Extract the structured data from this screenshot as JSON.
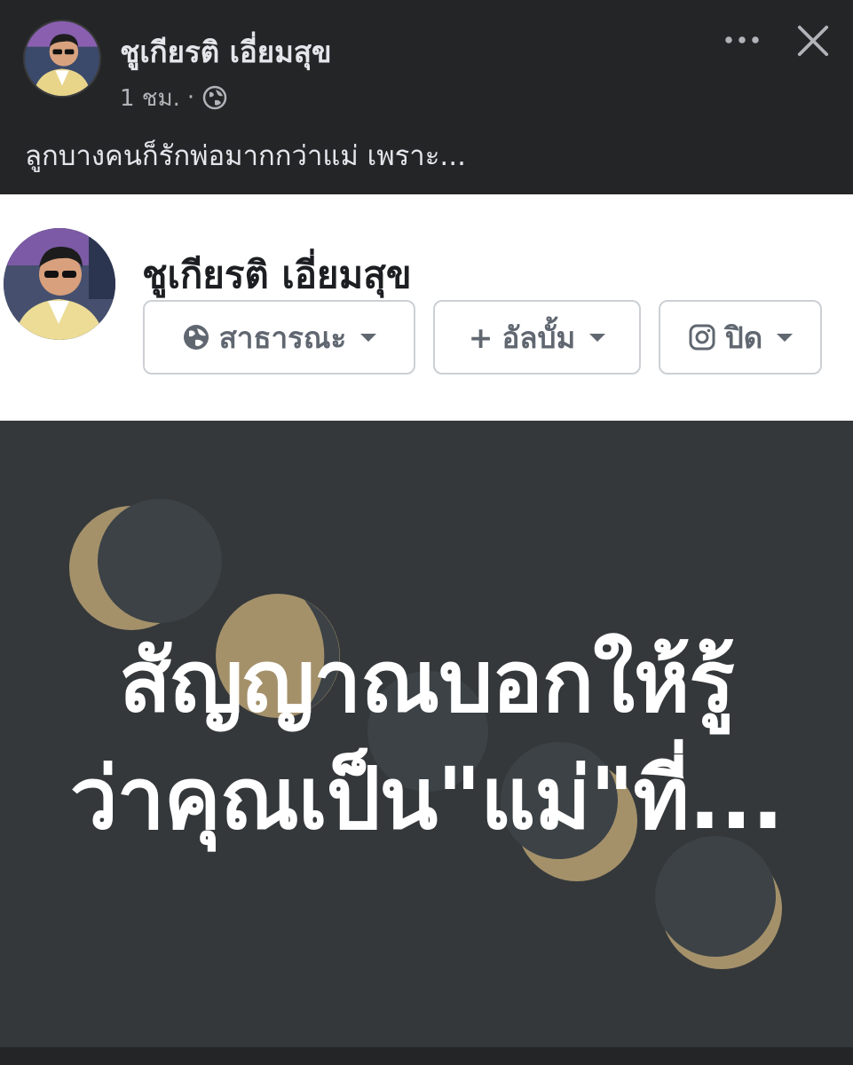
{
  "post": {
    "author": "ชูเกียรติ เอี่ยมสุข",
    "time": "1 ชม.",
    "separator": "·",
    "caption": "ลูกบางคนก็รักพ่อมากกว่าแม่ เพราะ...",
    "icons": {
      "audience": "globe-icon",
      "more": "more-options-icon",
      "close": "close-icon"
    }
  },
  "composer": {
    "author": "ชูเกียรติ เอี่ยมสุข",
    "privacy_label": "สาธารณะ",
    "album_label": "อัลบั้ม",
    "album_prefix": "+",
    "instagram_label": "ปิด",
    "icons": {
      "privacy": "globe-icon",
      "album": "plus-icon",
      "instagram": "instagram-icon",
      "dropdown": "caret-down-icon"
    }
  },
  "image": {
    "line1": "สัญญาณบอกให้รู้",
    "line2": "ว่าคุณเป็น\"แม่\"ที่...",
    "colors": {
      "background": "#34383b",
      "moon_dark": "#3c4246",
      "moon_gold": "#a4916a"
    }
  }
}
